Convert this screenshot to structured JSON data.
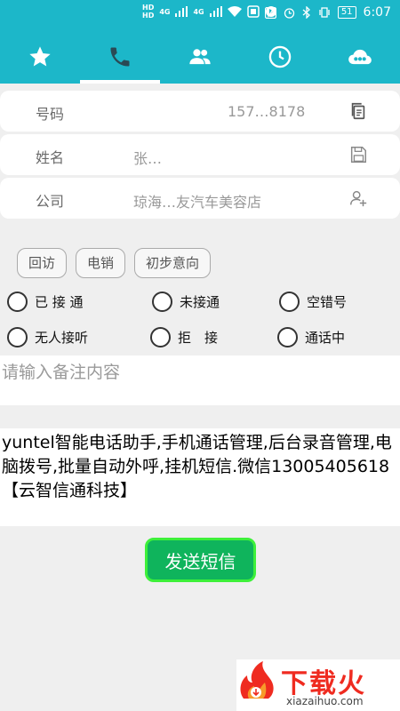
{
  "status_bar": {
    "sim_tags": [
      "HD",
      "HD"
    ],
    "network_left": "4G",
    "network_right": "4G",
    "battery": "51",
    "time": "6:07"
  },
  "tabs": [
    {
      "name": "favorites",
      "icon": "star-icon",
      "active": false
    },
    {
      "name": "calls",
      "icon": "phone-icon",
      "active": true
    },
    {
      "name": "contacts",
      "icon": "people-icon",
      "active": false
    },
    {
      "name": "history",
      "icon": "clock-icon",
      "active": false
    },
    {
      "name": "cloud",
      "icon": "cloud-icon",
      "active": false
    }
  ],
  "form": {
    "phone_label": "号码",
    "phone_value": "157…8178",
    "name_label": "姓名",
    "name_value": "张…",
    "company_label": "公司",
    "company_value": "琼海…友汽车美容店"
  },
  "tags": [
    "回访",
    "电销",
    "初步意向"
  ],
  "call_status_options": [
    {
      "label": "已 接 通"
    },
    {
      "label": "未接通"
    },
    {
      "label": "空错号"
    },
    {
      "label": "无人接听"
    },
    {
      "label": "拒　接"
    },
    {
      "label": "通话中"
    }
  ],
  "remark": {
    "placeholder": "请输入备注内容"
  },
  "sms": {
    "text": "yuntel智能电话助手,手机通话管理,后台录音管理,电脑拨号,批量自动外呼,挂机短信.微信13005405618【云智信通科技】",
    "send_label": "发送短信"
  },
  "watermark": {
    "logo_text": "下载火",
    "site": "xiazaihuo.com"
  },
  "colors": {
    "header": "#1cb7c9",
    "send_button": "#0fb45c",
    "watermark": "#ef2b20"
  }
}
